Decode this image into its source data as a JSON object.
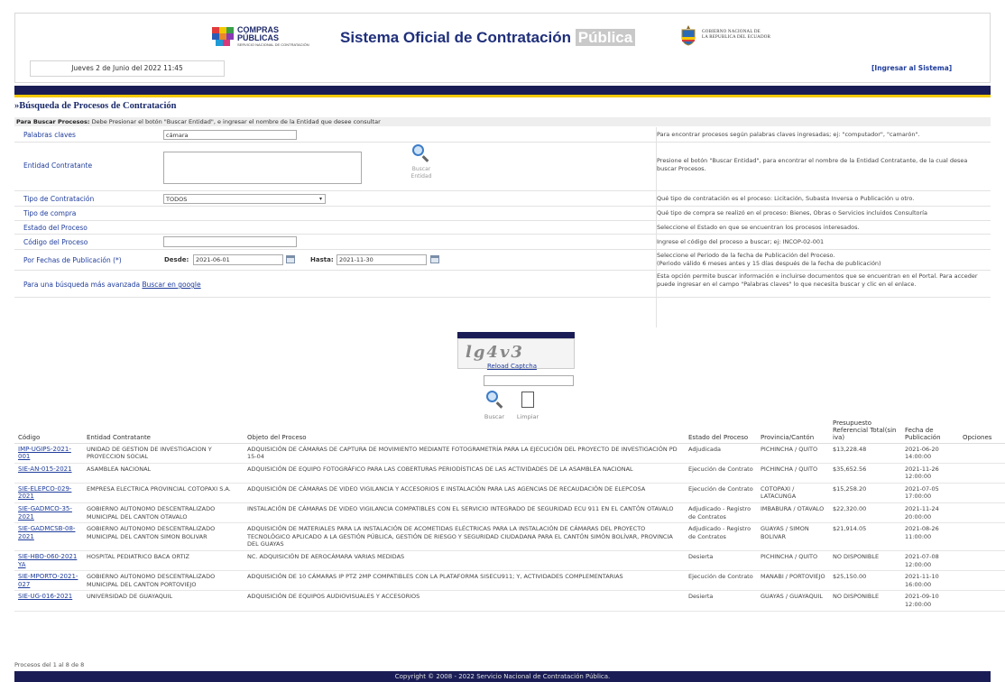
{
  "header": {
    "compras_line1": "COMPRAS",
    "compras_line2": "PÚBLICAS",
    "compras_tagline": "SERVICIO NACIONAL DE CONTRATACIÓN",
    "title_main": "Sistema Oficial de Contratación",
    "title_highlight": "Pública",
    "gob_line1": "GOBIERNO NACIONAL DE",
    "gob_line2": "LA REPUBLICA DEL ECUADOR",
    "date": "Jueves 2 de Junio del 2022 11:45",
    "login": "[Ingresar al Sistema]"
  },
  "search": {
    "title": "»Búsqueda de Procesos de Contratación",
    "help_bold": "Para Buscar Procesos:",
    "help_text": " Debe Presionar el botón \"Buscar Entidad\", e ingresar el nombre de la Entidad que desee consultar",
    "keywords": {
      "label": "Palabras claves",
      "value": "cámara",
      "desc": "Para encontrar procesos según palabras claves ingresadas; ej: \"computador\", \"camarón\"."
    },
    "entity": {
      "label": "Entidad Contratante",
      "value": "",
      "button": "Buscar Entidad",
      "desc": "Presione el botón \"Buscar Entidad\", para encontrar el nombre de la Entidad Contratante, de la cual desea buscar Procesos."
    },
    "contract_type": {
      "label": "Tipo de Contratación",
      "value": "TODOS",
      "desc": "Qué tipo de contratación es el proceso: Licitación, Subasta Inversa o Publicación u otro."
    },
    "purchase_type": {
      "label": "Tipo de compra",
      "desc": "Qué tipo de compra se realizó en el proceso: Bienes, Obras o Servicios incluidos Consultoría"
    },
    "process_state": {
      "label": "Estado del Proceso",
      "desc": "Seleccione el Estado en que se encuentran los procesos interesados."
    },
    "process_code": {
      "label": "Código del Proceso",
      "value": "",
      "desc": "Ingrese el código del proceso a buscar; ej: INCOP-02-001"
    },
    "dates": {
      "label": "Por Fechas de Publicación (*)",
      "from_label": "Desde:",
      "from": "2021-06-01",
      "to_label": "Hasta:",
      "to": "2021-11-30",
      "desc1": "Seleccione el Periodo de la fecha de Publicación del Proceso.",
      "desc2": "(Periodo válido 6 meses antes y 15 días después de la fecha de publicación)"
    },
    "advanced": {
      "label": "Para una búsqueda más avanzada",
      "link": "Buscar en google",
      "desc": "Esta opción permite buscar información e incluirse documentos que se encuentran en el Portal. Para acceder puede ingresar en el campo \"Palabras claves\" lo que necesita buscar y clic en el enlace."
    }
  },
  "captcha": {
    "text": "lg4v3",
    "reload": "Reload Captcha",
    "search_btn": "Buscar",
    "clear_btn": "Limpiar"
  },
  "results": {
    "headers": [
      "Código",
      "Entidad Contratante",
      "Objeto del Proceso",
      "Estado del Proceso",
      "Provincia/Cantón",
      "Presupuesto Referencial Total(sin iva)",
      "Fecha de Publicación",
      "Opciones"
    ],
    "rows": [
      {
        "code": "IMP-UGIPS-2021-001",
        "entity": "UNIDAD DE GESTION DE INVESTIGACION Y PROYECCION SOCIAL",
        "object": "ADQUISICIÓN DE CÁMARAS DE CAPTURA DE MOVIMIENTO MEDIANTE FOTOGRAMETRÍA PARA LA EJECUCIÓN DEL PROYECTO DE INVESTIGACIÓN PD 15-04",
        "state": "Adjudicada",
        "province": "PICHINCHA / QUITO",
        "budget": "$13,228.48",
        "date": "2021-06-20 14:00:00"
      },
      {
        "code": "SIE-AN-015-2021",
        "entity": "ASAMBLEA NACIONAL",
        "object": "ADQUISICIÓN DE EQUIPO FOTOGRÁFICO PARA LAS COBERTURAS PERIODÍSTICAS DE LAS ACTIVIDADES DE LA ASAMBLEA NACIONAL",
        "state": "Ejecución de Contrato",
        "province": "PICHINCHA / QUITO",
        "budget": "$35,652.56",
        "date": "2021-11-26 12:00:00"
      },
      {
        "code": "SIE-ELEPCO-029-2021",
        "entity": "EMPRESA ELECTRICA PROVINCIAL COTOPAXI S.A.",
        "object": "ADQUISICIÓN DE CÁMARAS DE VIDEO VIGILANCIA Y ACCESORIOS E INSTALACIÓN PARA LAS AGENCIAS DE RECAUDACIÓN DE ELEPCOSA",
        "state": "Ejecución de Contrato",
        "province": "COTOPAXI / LATACUNGA",
        "budget": "$15,258.20",
        "date": "2021-07-05 17:00:00"
      },
      {
        "code": "SIE-GADMCO-35-2021",
        "entity": "GOBIERNO AUTONOMO DESCENTRALIZADO MUNICIPAL DEL CANTON OTAVALO",
        "object": "INSTALACIÓN DE CÁMARAS DE VIDEO VIGILANCIA COMPATIBLES CON EL SERVICIO INTEGRADO DE SEGURIDAD ECU 911 EN EL CANTÓN OTAVALO",
        "state": "Adjudicado - Registro de Contratos",
        "province": "IMBABURA / OTAVALO",
        "budget": "$22,320.00",
        "date": "2021-11-24 20:00:00"
      },
      {
        "code": "SIE-GADMCSB-08-2021",
        "entity": "GOBIERNO AUTONOMO DESCENTRALIZADO MUNICIPAL DEL CANTON SIMON BOLIVAR",
        "object": "ADQUISICIÓN DE MATERIALES PARA LA INSTALACIÓN DE ACOMETIDAS ELÉCTRICAS PARA LA INSTALACIÓN DE CÁMARAS DEL PROYECTO TECNOLÓGICO APLICADO A LA GESTIÓN PÚBLICA, GESTIÓN DE RIESGO Y SEGURIDAD CIUDADANA PARA EL CANTÓN SIMÓN BOLÍVAR, PROVINCIA DEL GUAYAS",
        "state": "Adjudicado - Registro de Contratos",
        "province": "GUAYAS / SIMON BOLIVAR",
        "budget": "$21,914.05",
        "date": "2021-08-26 11:00:00"
      },
      {
        "code": "SIE-HBO-060-2021 YA",
        "entity": "HOSPITAL PEDIATRICO BACA ORTIZ",
        "object": "NC. ADQUISICIÓN DE AEROCÁMARA VARIAS MEDIDAS",
        "state": "Desierta",
        "province": "PICHINCHA / QUITO",
        "budget": "NO DISPONIBLE",
        "date": "2021-07-08 12:00:00"
      },
      {
        "code": "SIE-MPORTO-2021-027",
        "entity": "GOBIERNO AUTONOMO DESCENTRALIZADO MUNICIPAL DEL CANTON PORTOVIEJO",
        "object": "ADQUISICIÓN DE 10 CÁMARAS IP PTZ 2MP COMPATIBLES CON LA PLATAFORMA SISECU911; Y, ACTIVIDADES COMPLEMENTARIAS",
        "state": "Ejecución de Contrato",
        "province": "MANABI / PORTOVIEJO",
        "budget": "$25,150.00",
        "date": "2021-11-10 16:00:00"
      },
      {
        "code": "SIE-UG-016-2021",
        "entity": "UNIVERSIDAD DE GUAYAQUIL",
        "object": "ADQUISICIÓN DE EQUIPOS AUDIOVISUALES Y ACCESORIOS",
        "state": "Desierta",
        "province": "GUAYAS / GUAYAQUIL",
        "budget": "NO DISPONIBLE",
        "date": "2021-09-10 12:00:00"
      }
    ],
    "count": "Procesos del 1 al 8 de 8"
  },
  "footer": "Copyright © 2008 - 2022 Servicio Nacional de Contratación Pública."
}
